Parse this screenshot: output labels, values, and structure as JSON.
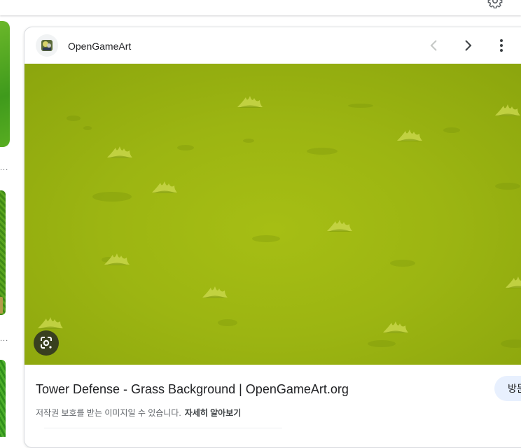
{
  "top_bar": {
    "settings_icon": "gear-icon"
  },
  "side_thumbnails": [
    {
      "ellipsis": "..."
    },
    {
      "ellipsis": "..."
    },
    {
      "ellipsis": ""
    }
  ],
  "card": {
    "site_name": "OpenGameArt",
    "site_icon": "opengameart-logo",
    "prev_icon": "chevron-left-icon",
    "next_icon": "chevron-right-icon",
    "more_icon": "more-vert-icon",
    "lens_icon": "google-lens-icon",
    "title": "Tower Defense - Grass Background | OpenGameArt.org",
    "visit_label": "방문",
    "copyright_notice": "저작권 보호를 받는 이미지일 수 있습니다.",
    "learn_more": "자세히 알아보기"
  },
  "colors": {
    "grass": "#9cb512",
    "visit_button_bg": "#e8f0fe",
    "lens_button_bg": "#202124"
  }
}
